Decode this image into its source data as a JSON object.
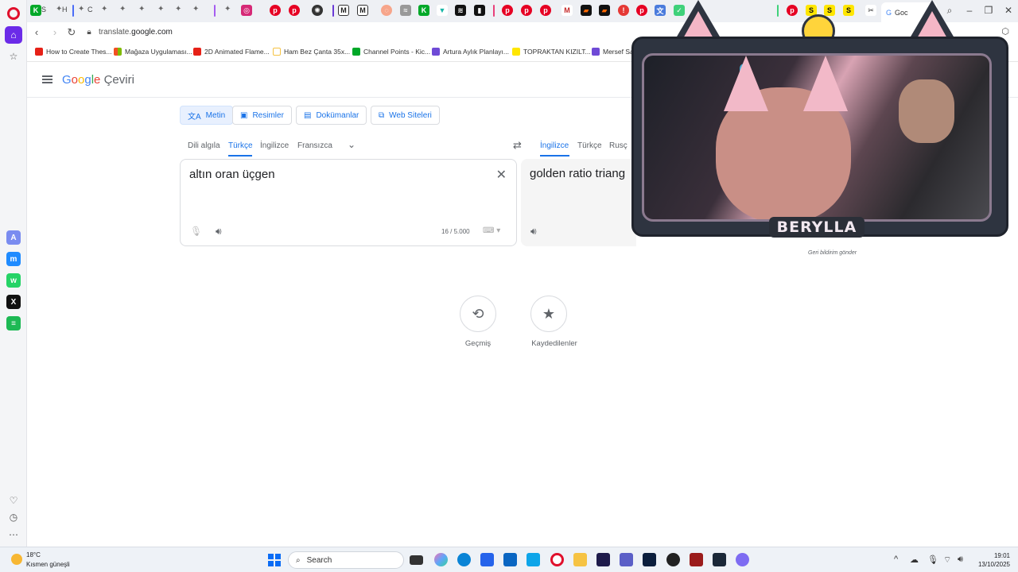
{
  "tabstrip": {
    "tab_labels": [
      "S",
      "H",
      "C"
    ],
    "active_tab": "Goc",
    "tab_icons": [
      {
        "letter": "K",
        "color": "#00a828"
      },
      {
        "letter": "M",
        "color": "#222222"
      },
      {
        "letter": "M",
        "color": "#222222"
      },
      {
        "letter": "K",
        "color": "#00a828"
      },
      {
        "letter": "S",
        "color": "#ffe600"
      },
      {
        "letter": "S",
        "color": "#ffe600"
      },
      {
        "letter": "S",
        "color": "#ffe600"
      }
    ]
  },
  "addressbar": {
    "url_prefix": "translate.",
    "url_domain": "google.com"
  },
  "bookmarks": [
    {
      "label": "How to Create Thes...",
      "color": "#e62117"
    },
    {
      "label": "Mağaza Uygulaması...",
      "color": "#f25022"
    },
    {
      "label": "2D Animated Flame...",
      "color": "#e62117"
    },
    {
      "label": "Ham Bez Çanta 35x...",
      "color": "#f6c343"
    },
    {
      "label": "Channel Points - Kic...",
      "color": "#00a828"
    },
    {
      "label": "Artura Aylık Planlayı...",
      "color": "#6f4ad6"
    },
    {
      "label": "TOPRAKTAN KIZILT...",
      "color": "#ffe600"
    },
    {
      "label": "Mersef Sa",
      "color": "#6f4ad6"
    }
  ],
  "translate": {
    "logo_google": [
      "G",
      "o",
      "o",
      "g",
      "l",
      "e"
    ],
    "logo_product": "Çeviri",
    "modes": [
      {
        "label": "Metin",
        "icon": "translate-icon"
      },
      {
        "label": "Resimler",
        "icon": "image-icon"
      },
      {
        "label": "Dokümanlar",
        "icon": "document-icon"
      },
      {
        "label": "Web Siteleri",
        "icon": "web-icon"
      }
    ],
    "source_langs": [
      "Dili algıla",
      "Türkçe",
      "İngilizce",
      "Fransızca"
    ],
    "target_langs": [
      "İngilizce",
      "Türkçe",
      "Rusç"
    ],
    "source_text": "altın oran üçgen",
    "target_text": "golden ratio triang",
    "char_count": "16 / 5.000",
    "feedback": "Geri bildirim gönder",
    "history_label": "Geçmiş",
    "saved_label": "Kaydedilenler"
  },
  "overlay": {
    "streamer_name": "BERYLLA"
  },
  "taskbar": {
    "temperature": "18°C",
    "weather_desc": "Kısmen güneşli",
    "search_label": "Search",
    "time": "19:01",
    "date": "13/10/2025"
  }
}
